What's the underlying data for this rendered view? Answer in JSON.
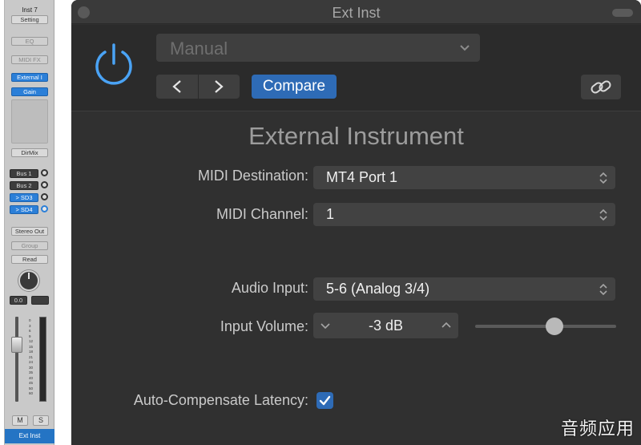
{
  "strip": {
    "name_top": "Inst 7",
    "setting": "Setting",
    "eq": "EQ",
    "midi_fx": "MIDI FX",
    "instrument": "External I",
    "insert": "Gain",
    "dirmix": "DirMix",
    "sends": [
      {
        "label": "Bus 1",
        "active": false
      },
      {
        "label": "Bus 2",
        "active": false
      },
      {
        "label": "> SD3",
        "active": true
      },
      {
        "label": "> SD4",
        "active": true
      }
    ],
    "output": "Stereo Out",
    "group": "Group",
    "automation": "Read",
    "volume_readout": "0.0",
    "meter_scale": [
      "0",
      "3",
      "6",
      "9",
      "12",
      "15",
      "18",
      "21",
      "24",
      "30",
      "35",
      "40",
      "45",
      "50",
      "60"
    ],
    "mute": "M",
    "solo": "S",
    "channel_name": "Ext Inst"
  },
  "window": {
    "title": "Ext Inst"
  },
  "header": {
    "preset": "Manual",
    "compare": "Compare"
  },
  "plugin": {
    "heading": "External Instrument",
    "midi_destination": {
      "label": "MIDI Destination:",
      "value": "MT4 Port 1"
    },
    "midi_channel": {
      "label": "MIDI Channel:",
      "value": "1"
    },
    "audio_input": {
      "label": "Audio Input:",
      "value": "5-6 (Analog 3/4)"
    },
    "input_volume": {
      "label": "Input Volume:",
      "value": "-3 dB",
      "slider_position": 0.56
    },
    "latency": {
      "label": "Auto-Compensate Latency:",
      "checked": true
    }
  },
  "colors": {
    "accent": "#2e6bb6",
    "power": "#4aa3f5",
    "panel": "#303030"
  },
  "watermark": "音频应用"
}
